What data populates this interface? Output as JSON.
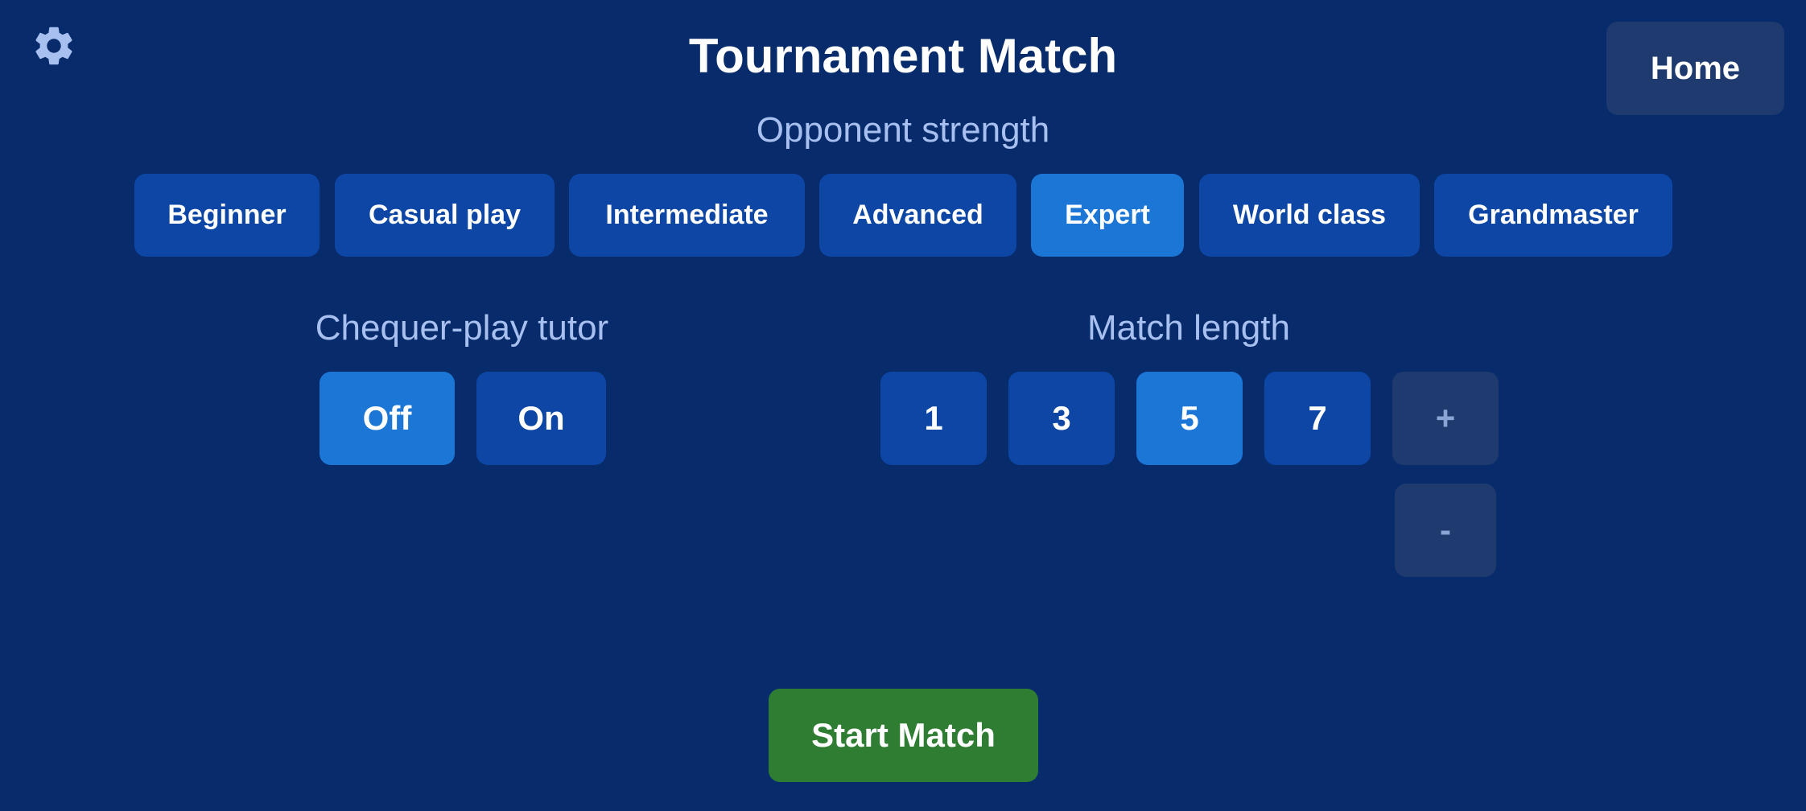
{
  "header": {
    "title": "Tournament Match",
    "settings_icon": "gear-icon",
    "home_label": "Home"
  },
  "opponent_strength": {
    "label": "Opponent strength",
    "options": [
      "Beginner",
      "Casual play",
      "Intermediate",
      "Advanced",
      "Expert",
      "World class",
      "Grandmaster"
    ],
    "selected": "Expert"
  },
  "tutor": {
    "label": "Chequer-play tutor",
    "options": [
      "Off",
      "On"
    ],
    "selected": "Off"
  },
  "match_length": {
    "label": "Match length",
    "options": [
      "1",
      "3",
      "5",
      "7"
    ],
    "selected": "5",
    "increment_label": "+",
    "decrement_label": "-"
  },
  "actions": {
    "start_label": "Start Match"
  },
  "colors": {
    "background": "#072b6b",
    "button": "#0d46a4",
    "button_selected": "#1b76d6",
    "button_muted": "#1e3a6e",
    "label_text": "#a8c0f0",
    "start_button": "#2e7d32"
  }
}
